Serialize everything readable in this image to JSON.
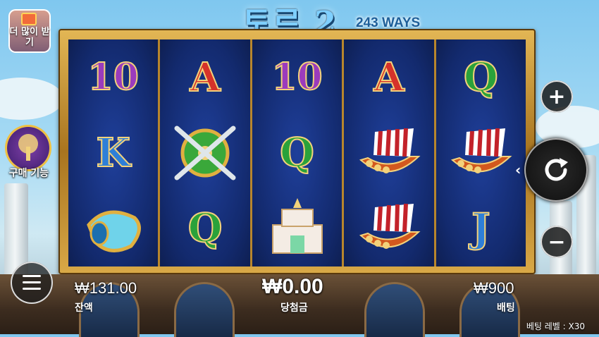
{
  "game": {
    "title": "토르 2",
    "ways": "243 WAYS"
  },
  "left_panel": {
    "more_button_label": "더 많이 받기",
    "buy_feature_label": "구매 기능"
  },
  "reels": [
    [
      "10",
      "K",
      "horn"
    ],
    [
      "A",
      "shield",
      "Q"
    ],
    [
      "10",
      "Q",
      "temple"
    ],
    [
      "A",
      "ship",
      "ship"
    ],
    [
      "Q",
      "ship",
      "J"
    ]
  ],
  "symbol_colors": {
    "10": "#9b3bbd",
    "A": "#d6322a",
    "Q": "#2aa23a",
    "K": "#2e7fd8",
    "J": "#2e7fd8"
  },
  "bottom_bar": {
    "balance_value": "₩131.00",
    "balance_label": "잔액",
    "win_value": "₩0.00",
    "win_label": "당첨금",
    "bet_value": "₩900",
    "bet_label": "배팅",
    "bet_level": "베팅 레벨 : X30"
  },
  "controls": {
    "plus_symbol": "+",
    "minus_symbol": "−"
  }
}
